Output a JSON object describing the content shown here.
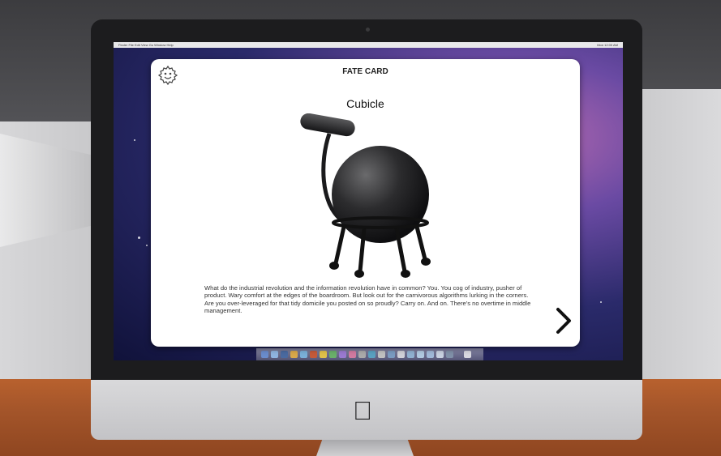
{
  "menubar": {
    "items": "Finder  File  Edit  View  Go  Window  Help",
    "status": "Mon 12:00 AM"
  },
  "card": {
    "header": "FATE CARD",
    "title": "Cubicle",
    "body": "What do the industrial revolution and the information revolution have in common? You. You cog of industry, pusher of product. Wary comfort at the edges of the boardroom. But look out for the carnivorous algorithms lurking in the corners. Are you over-leveraged for that tidy domicile you posted on so proudly? Carry on. And on. There's no overtime in middle management.",
    "image": "ball-chair-image",
    "next_icon": "chevron-right-icon",
    "settings_icon": "gear-icon"
  },
  "device": {
    "logo": "apple-logo-icon"
  },
  "colors": {
    "card_bg": "#ffffff",
    "desk": "#a4552a",
    "bezel": "#1c1c1e"
  }
}
